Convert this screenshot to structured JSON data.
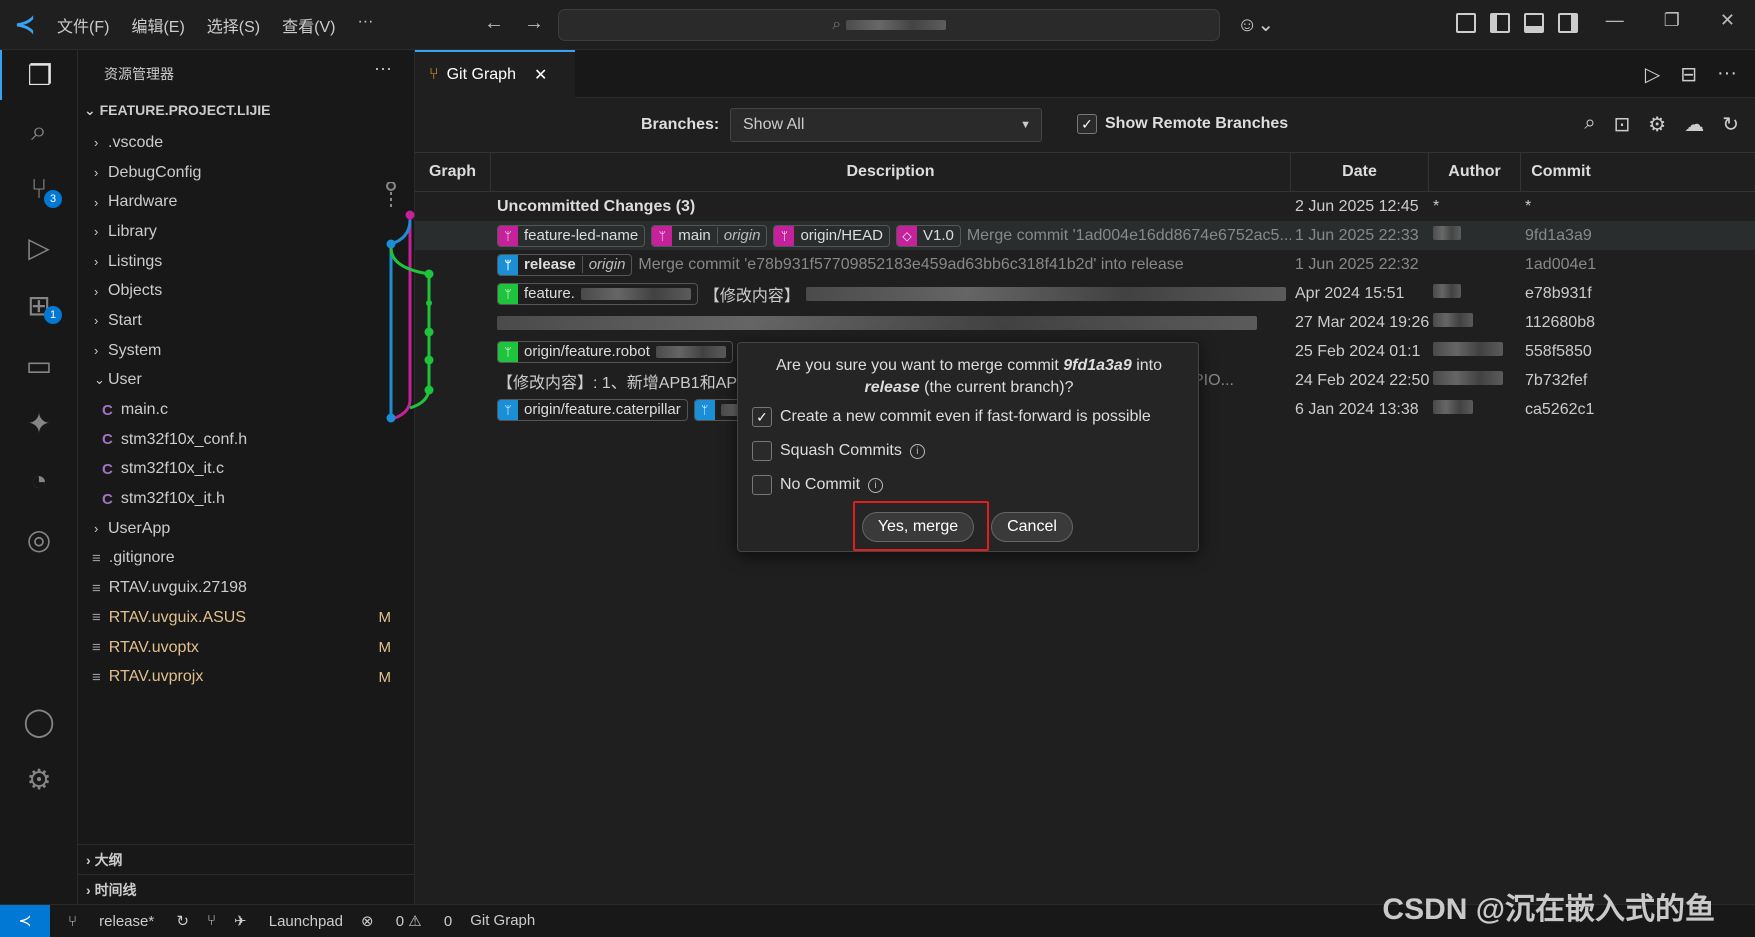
{
  "menu": [
    "文件(F)",
    "编辑(E)",
    "选择(S)",
    "查看(V)",
    "···"
  ],
  "sidebar": {
    "title": "资源管理器",
    "project": "FEATURE.PROJECT.LIJIE",
    "items": [
      {
        "label": ".vscode",
        "kind": "folder"
      },
      {
        "label": "DebugConfig",
        "kind": "folder"
      },
      {
        "label": "Hardware",
        "kind": "folder"
      },
      {
        "label": "Library",
        "kind": "folder"
      },
      {
        "label": "Listings",
        "kind": "folder"
      },
      {
        "label": "Objects",
        "kind": "folder"
      },
      {
        "label": "Start",
        "kind": "folder"
      },
      {
        "label": "System",
        "kind": "folder"
      },
      {
        "label": "User",
        "kind": "folder-open"
      },
      {
        "label": "main.c",
        "kind": "c"
      },
      {
        "label": "stm32f10x_conf.h",
        "kind": "c"
      },
      {
        "label": "stm32f10x_it.c",
        "kind": "c"
      },
      {
        "label": "stm32f10x_it.h",
        "kind": "c"
      },
      {
        "label": "UserApp",
        "kind": "folder"
      },
      {
        "label": ".gitignore",
        "kind": "file"
      },
      {
        "label": "RTAV.uvguix.27198",
        "kind": "file"
      },
      {
        "label": "RTAV.uvguix.ASUS",
        "kind": "file",
        "status": "M"
      },
      {
        "label": "RTAV.uvoptx",
        "kind": "file",
        "status": "M"
      },
      {
        "label": "RTAV.uvprojx",
        "kind": "file",
        "status": "M"
      }
    ],
    "outline": "大纲",
    "timeline": "时间线"
  },
  "activity_badges": {
    "scm": "3",
    "extensions": "1"
  },
  "tab": {
    "label": "Git Graph"
  },
  "controls": {
    "branches_label": "Branches:",
    "branches_value": "Show All",
    "remote_label": "Show Remote Branches"
  },
  "columns": {
    "graph": "Graph",
    "description": "Description",
    "date": "Date",
    "author": "Author",
    "commit": "Commit"
  },
  "rows": [
    {
      "desc": "Uncommitted Changes (3)",
      "date": "2 Jun 2025 12:45",
      "author": "*",
      "commit": "*"
    },
    {
      "refs": [
        "feature-led-name",
        "main",
        "origin/HEAD",
        "V1.0"
      ],
      "desc": "Merge commit '1ad004e16dd8674e6752ac5...",
      "date": "1 Jun 2025 22:33",
      "author": "",
      "commit": "9fd1a3a9"
    },
    {
      "refs": [
        "release",
        "origin"
      ],
      "desc": "Merge commit 'e78b931f57709852183e459ad63bb6c318f41b2d' into release",
      "date": "1 Jun 2025 22:32",
      "author": "",
      "commit": "1ad004e1"
    },
    {
      "refs": [
        "feature."
      ],
      "desc": "【修改内容】",
      "date": "Apr 2024 15:51",
      "author": "",
      "commit": "e78b931f"
    },
    {
      "desc": "",
      "date": "27 Mar 2024 19:26",
      "author": "",
      "commit": "112680b8"
    },
    {
      "refs": [
        "origin/feature.robot"
      ],
      "desc": "",
      "date": "25 Feb 2024 01:1",
      "author": "",
      "commit": "558f5850"
    },
    {
      "desc": "【修改内容】: 1、新增APB1和APB2总线",
      "desc_tail": "PIO...",
      "date": "24 Feb 2024 22:50",
      "author": "",
      "commit": "7b732fef"
    },
    {
      "refs": [
        "origin/feature.caterpillar"
      ],
      "desc": "",
      "date": "6 Jan 2024 13:38",
      "author": "",
      "commit": "ca5262c1"
    }
  ],
  "dialog": {
    "q_prefix": "Are you sure you want to merge commit",
    "commit": "9fd1a3a9",
    "q_into": "into",
    "branch": "release",
    "q_suffix": "(the current branch)?",
    "opt1": "Create a new commit even if fast-forward is possible",
    "opt2": "Squash Commits",
    "opt3": "No Commit",
    "confirm": "Yes, merge",
    "cancel": "Cancel"
  },
  "status": {
    "branch": "release*",
    "launchpad": "Launchpad",
    "errors": "0",
    "warnings": "0",
    "gitgraph": "Git Graph"
  },
  "watermark": "CSDN @沉在嵌入式的鱼",
  "colors": {
    "accent": "#0078d4",
    "magenta": "#c4219a",
    "blue": "#1a8fd8",
    "green": "#1ec43c",
    "highlight": "#e02020"
  }
}
